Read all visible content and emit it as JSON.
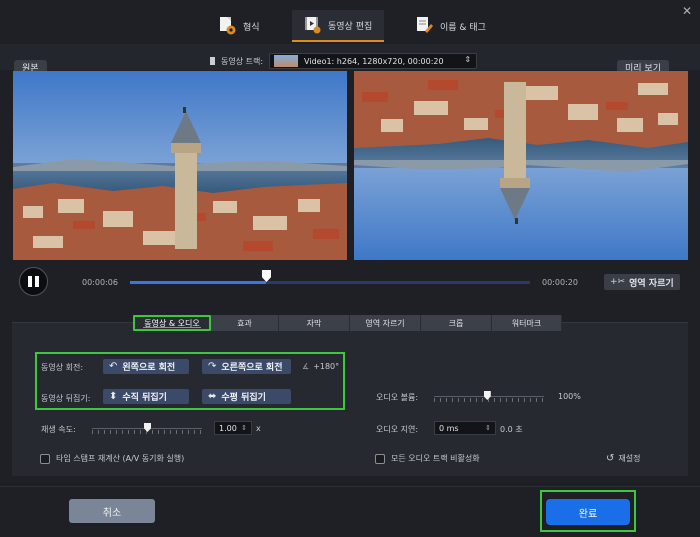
{
  "tabs": [
    {
      "label": "형식",
      "icon": "format-gear-icon"
    },
    {
      "label": "동영상 편집",
      "icon": "video-edit-icon"
    },
    {
      "label": "이름 & 태그",
      "icon": "tag-edit-icon"
    }
  ],
  "header": {
    "original_label": "원본",
    "preview_label": "미리 보기",
    "track_label": "동영상 트랙:",
    "track_value": "Video1: h264, 1280x720, 00:00:20"
  },
  "playback": {
    "current_time": "00:00:06",
    "end_time": "00:00:20",
    "progress_fraction": 0.34,
    "crop_button": "영역 자르기"
  },
  "edit_tabs": [
    "동영상 & 오디오",
    "효과",
    "자막",
    "영역 자르기",
    "크롭",
    "워터마크"
  ],
  "video_audio": {
    "rotate_label": "동영상 회전:",
    "rotate_left": "왼쪽으로 회전",
    "rotate_right": "오른쪽으로 회전",
    "rotate_value": "+180°",
    "flip_label": "동영상 뒤집기:",
    "flip_vertical": "수직 뒤집기",
    "flip_horizontal": "수평 뒤집기",
    "speed_label": "재생 속도:",
    "speed_value": "1.00",
    "speed_unit": "x",
    "speed_fraction": 0.5,
    "volume_label": "오디오 볼륨:",
    "volume_value": "100%",
    "volume_fraction": 0.48,
    "delay_label": "오디오 지연:",
    "delay_value": "0 ms",
    "delay_seconds": "0.0 초",
    "timestamp_checkbox": "타임 스탬프 재계산 (A/V 동기화 실행)",
    "disable_audio_checkbox": "모든 오디오 트랙 비활성화",
    "reset_label": "재설정"
  },
  "footer": {
    "cancel": "취소",
    "done": "완료"
  },
  "colors": {
    "highlight_green": "#3ec63e",
    "accent_blue": "#1a6fe8",
    "tab_accent_orange": "#e08a1e"
  }
}
